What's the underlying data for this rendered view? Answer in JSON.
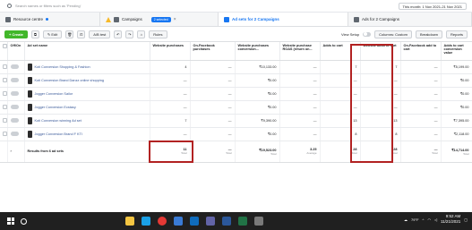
{
  "search": {
    "placeholder": "Search names or filters such as 'Pending'"
  },
  "date_range": "This month: 1 Nov 2021-21 Nov 2021",
  "levels": {
    "resource_centre": "Resource centre",
    "campaigns": "Campaigns",
    "selected_chip": "2 selected",
    "ad_sets": "Ad sets for 2 Campaigns",
    "ads": "Ads for 2 Campaigns"
  },
  "toolbar": {
    "create": "+ Create",
    "edit": "Edit",
    "ab_test": "A/B test",
    "rules": "Rules",
    "view_setup": "View Setup",
    "columns": "Columns: Custom",
    "breakdown": "Breakdown",
    "reports": "Reports"
  },
  "table": {
    "headers": [
      "Off/On",
      "Ad set name",
      "Website purchases",
      "On-Facebook purchases",
      "Website purchases conversion...",
      "Website purchase ROAS (return on...",
      "Adds to cart",
      "Website adds to cart",
      "On-Facebook add to cart",
      "Adds to cart conversion value"
    ],
    "rows": [
      {
        "name": "Koti Conversion Shopping & Fashion",
        "c1": "4",
        "c2": "—",
        "c3": "₹10,133.00",
        "c4": "—",
        "c5": "7",
        "c6": "7",
        "c7": "—",
        "c8": "₹5,199.00"
      },
      {
        "name": "Koti Conversion Brand Danzz online shopping",
        "c1": "—",
        "c2": "—",
        "c3": "₹0.00",
        "c4": "—",
        "c5": "—",
        "c6": "—",
        "c7": "—",
        "c8": "₹0.00"
      },
      {
        "name": "Jogger Conversion Sailor",
        "c1": "—",
        "c2": "—",
        "c3": "₹0.00",
        "c4": "—",
        "c5": "—",
        "c6": "—",
        "c7": "—",
        "c8": "₹0.00"
      },
      {
        "name": "Jogger Conversion Ecstasy",
        "c1": "—",
        "c2": "—",
        "c3": "₹0.00",
        "c4": "—",
        "c5": "—",
        "c6": "—",
        "c7": "—",
        "c8": "₹0.00"
      },
      {
        "name": "Koti Conversion winning Ad set",
        "c1": "7",
        "c2": "—",
        "c3": "₹9,390.00",
        "c4": "—",
        "c5": "13",
        "c6": "13",
        "c7": "—",
        "c8": "₹7,395.00"
      },
      {
        "name": "Jogger Conversion Brand F KTI",
        "c1": "—",
        "c2": "—",
        "c3": "₹0.00",
        "c4": "—",
        "c5": "8",
        "c6": "8",
        "c7": "—",
        "c8": "₹2,118.00"
      }
    ],
    "results": {
      "label": "Results from 6 ad sets",
      "c1": "11",
      "c2": "—",
      "c3": "₹19,523.00",
      "c4": "3.25",
      "c5": "28",
      "c6": "28",
      "c7": "—",
      "c8": "₹14,714.00",
      "sub_total": "Total",
      "sub_avg": "Average"
    }
  },
  "taskbar": {
    "weather": "79°F",
    "time": "9:52 AM",
    "date": "11/21/2021"
  },
  "colors": {
    "accent": "#1877f2",
    "create": "#42b72a",
    "highlight": "#b22222",
    "taskbar": "#202020"
  }
}
